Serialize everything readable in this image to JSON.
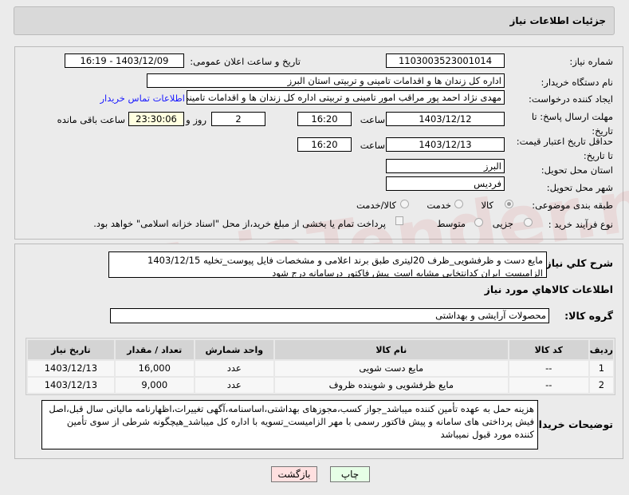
{
  "header": {
    "title": "جزئیات اطلاعات نیاز"
  },
  "form": {
    "need_number_label": "شماره نیاز:",
    "need_number": "1103003523001014",
    "announce_label": "تاریخ و ساعت اعلان عمومی:",
    "announce_value": "1403/12/09 - 16:19",
    "buyer_org_label": "نام دستگاه خریدار:",
    "buyer_org": "اداره کل زندان ها و اقدامات تامینی و تربیتی استان البرز",
    "creator_label": "ایجاد کننده درخواست:",
    "creator": "مهدی نژاد احمد پور مراقب امور تامینی و تربیتی اداره کل زندان ها و اقدامات تامینی",
    "contact_link": "اطلاعات تماس خریدار",
    "deadline_label": "مهلت ارسال پاسخ: تا تاریخ:",
    "deadline_date": "1403/12/12",
    "time_label": "ساعت",
    "deadline_time": "16:20",
    "days": "2",
    "days_label": "روز و",
    "remaining": "23:30:06",
    "remaining_label": "ساعت باقی مانده",
    "validity_label": "حداقل تاریخ اعتبار قیمت: تا تاریخ:",
    "validity_date": "1403/12/13",
    "validity_time": "16:20",
    "province_label": "استان محل تحویل:",
    "province": "البرز",
    "city_label": "شهر محل تحویل:",
    "city": "فردیس",
    "category_label": "طبقه بندی موضوعی:",
    "category_options": [
      "کالا",
      "خدمت",
      "کالا/خدمت"
    ],
    "process_label": "نوع فرآیند خرید :",
    "process_options": [
      "جزیی",
      "متوسط"
    ],
    "payment_note": "پرداخت تمام یا بخشی از مبلغ خرید،از محل \"اسناد خزانه اسلامی\" خواهد بود."
  },
  "details": {
    "summary_label": "شرح کلي نياز:",
    "summary": "مایع دست و ظرفشویی_ظرف 20لیتری طبق برند اعلامی و مشخصات فایل پیوست_تخلیه 1403/12/15 الزامیست_ایران کدانتخابی مشابه است_پیش فاکتور درسامانه درج شود",
    "goods_heading": "اطلاعات کالاهاي مورد نياز",
    "group_label": "گروه کالا:",
    "group": "محصولات آرایشی و بهداشتی",
    "table": {
      "headers": [
        "ردیف",
        "کد کالا",
        "نام کالا",
        "واحد شمارش",
        "تعداد / مقدار",
        "تاریخ نیاز"
      ],
      "rows": [
        [
          "1",
          "--",
          "مایع دست شویی",
          "عدد",
          "16,000",
          "1403/12/13"
        ],
        [
          "2",
          "--",
          "مایع ظرفشویی و شوینده ظروف",
          "عدد",
          "9,000",
          "1403/12/13"
        ]
      ]
    },
    "notes_label": "توضیحات خریدار:",
    "notes": "هزینه حمل به عهده تأمین کننده میباشد_جواز کسب،مجوزهای بهداشتی،اساسنامه،آگهی تغییرات،اظهارنامه مالیاتی سال قبل،اصل فیش پرداختی های سامانه و پیش فاکتور رسمی با مهر الزامیست_تسویه با اداره کل میباشد_هیچگونه شرطی از سوی تأمین کننده مورد قبول نمیباشد"
  },
  "buttons": {
    "print": "چاپ",
    "back": "بازگشت"
  },
  "watermark": "AriaTender.net"
}
